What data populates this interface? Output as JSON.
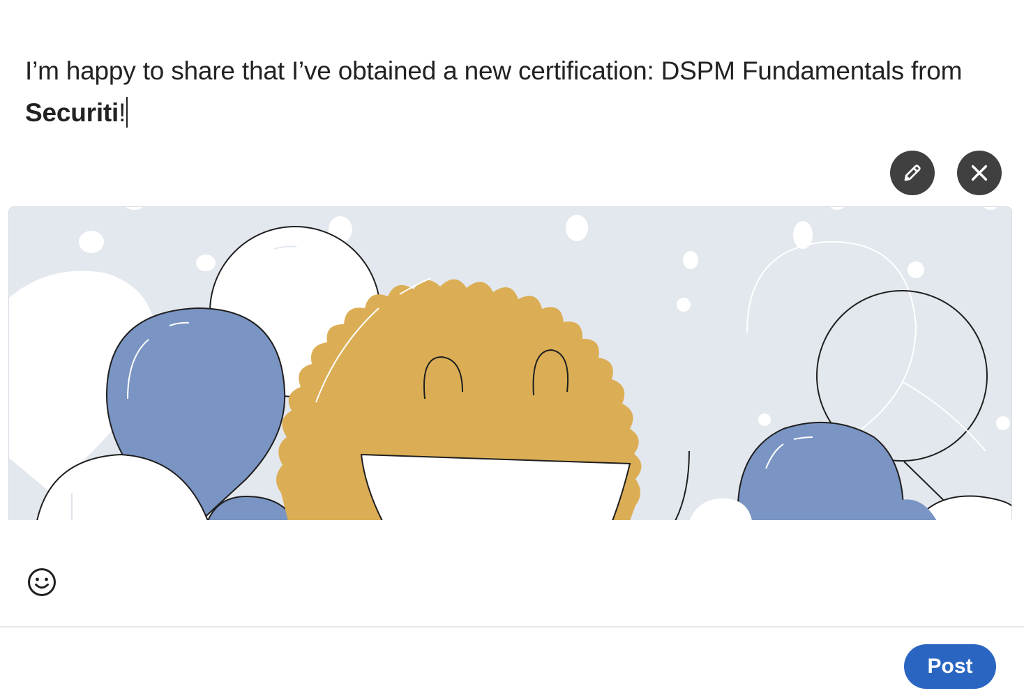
{
  "post": {
    "text_before": "I’m happy to share that I’ve obtained a new certification: DSPM Fundamentals from ",
    "mention": "Securiti",
    "text_after": "!"
  },
  "media": {
    "edit_icon": "pencil-icon",
    "remove_icon": "close-icon",
    "image_icon": "certification-badge-balloons-illustration",
    "colors": {
      "background": "#e3e7ee",
      "badge": "#dbae55",
      "balloon_blue": "#7a95c3",
      "balloon_white": "#ffffff"
    }
  },
  "toolbar": {
    "emoji_icon": "smiley-icon"
  },
  "footer": {
    "post_label": "Post",
    "post_color": "#2a66c1"
  }
}
